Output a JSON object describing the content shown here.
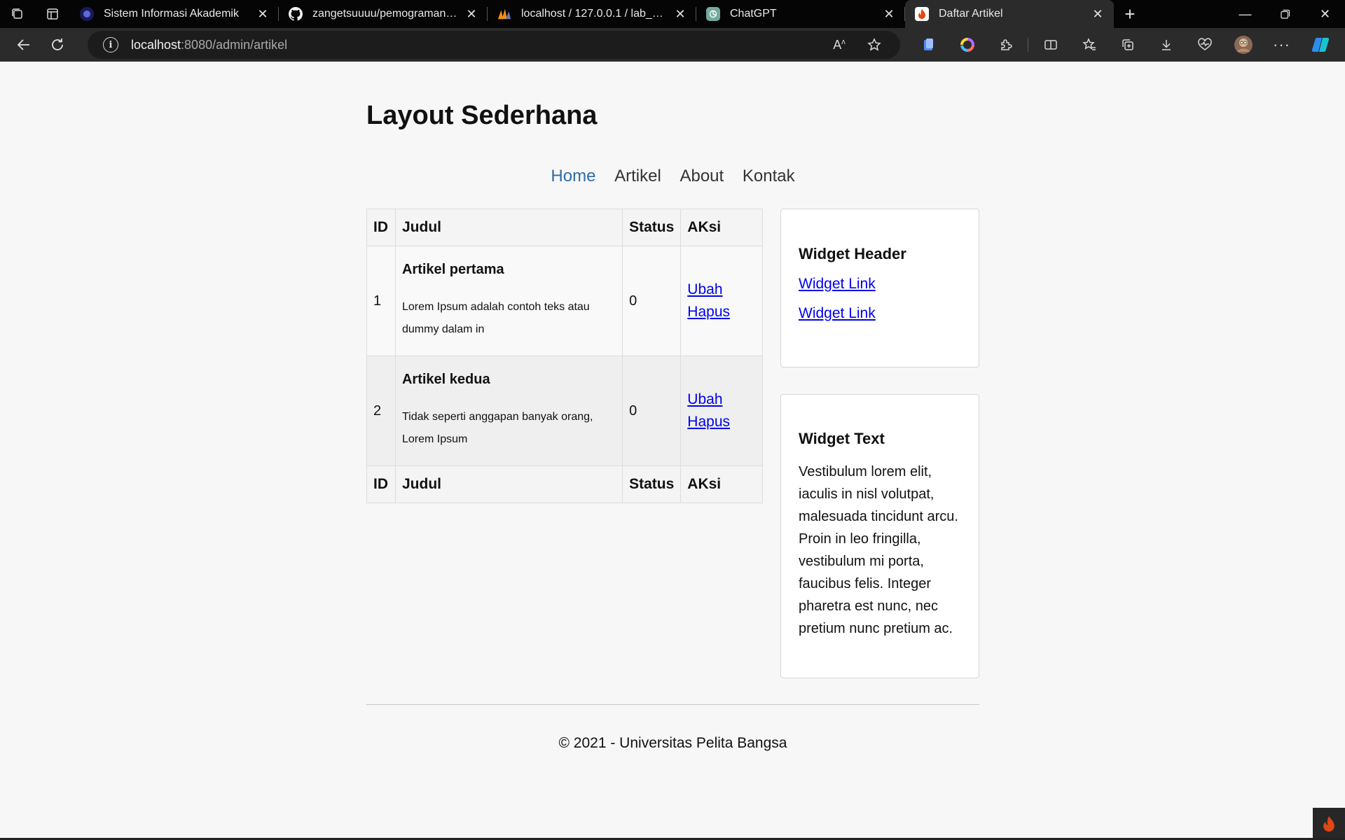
{
  "browser": {
    "tabs": [
      {
        "title": "Sistem Informasi Akademik",
        "icon": "university-logo-icon",
        "active": false
      },
      {
        "title": "zangetsuuuu/pemograman-web",
        "icon": "github-icon",
        "active": false
      },
      {
        "title": "localhost / 127.0.0.1 / lab_ci4 | ph",
        "icon": "phpmyadmin-icon",
        "active": false
      },
      {
        "title": "ChatGPT",
        "icon": "chatgpt-icon",
        "active": false
      },
      {
        "title": "Daftar Artikel",
        "icon": "codeigniter-icon",
        "active": true
      }
    ],
    "url_host": "localhost",
    "url_rest": ":8080/admin/artikel"
  },
  "site": {
    "title": "Layout Sederhana",
    "nav": [
      "Home",
      "Artikel",
      "About",
      "Kontak"
    ],
    "active_nav": "Home"
  },
  "table": {
    "headers": {
      "id": "ID",
      "judul": "Judul",
      "status": "Status",
      "aksi": "AKsi"
    },
    "rows": [
      {
        "id": "1",
        "title": "Artikel pertama",
        "body": "Lorem Ipsum adalah contoh teks atau dummy dalam in",
        "status": "0",
        "edit": "Ubah",
        "delete": "Hapus"
      },
      {
        "id": "2",
        "title": "Artikel kedua",
        "body": "Tidak seperti anggapan banyak orang, Lorem Ipsum",
        "status": "0",
        "edit": "Ubah",
        "delete": "Hapus"
      }
    ]
  },
  "widgets": {
    "header_title": "Widget Header",
    "links": [
      "Widget Link",
      "Widget Link"
    ],
    "text_title": "Widget Text",
    "text_body": "Vestibulum lorem elit, iaculis in nisl volutpat, malesuada tincidunt arcu. Proin in leo fringilla, vestibulum mi porta, faucibus felis. Integer pharetra est nunc, nec pretium nunc pretium ac."
  },
  "footer": {
    "text": "© 2021 - Universitas Pelita Bangsa"
  },
  "colors": {
    "active_nav": "#2e6da4",
    "link": "#0000ee",
    "chrome_bg": "#050505",
    "toolbar_bg": "#2b2b2b"
  }
}
